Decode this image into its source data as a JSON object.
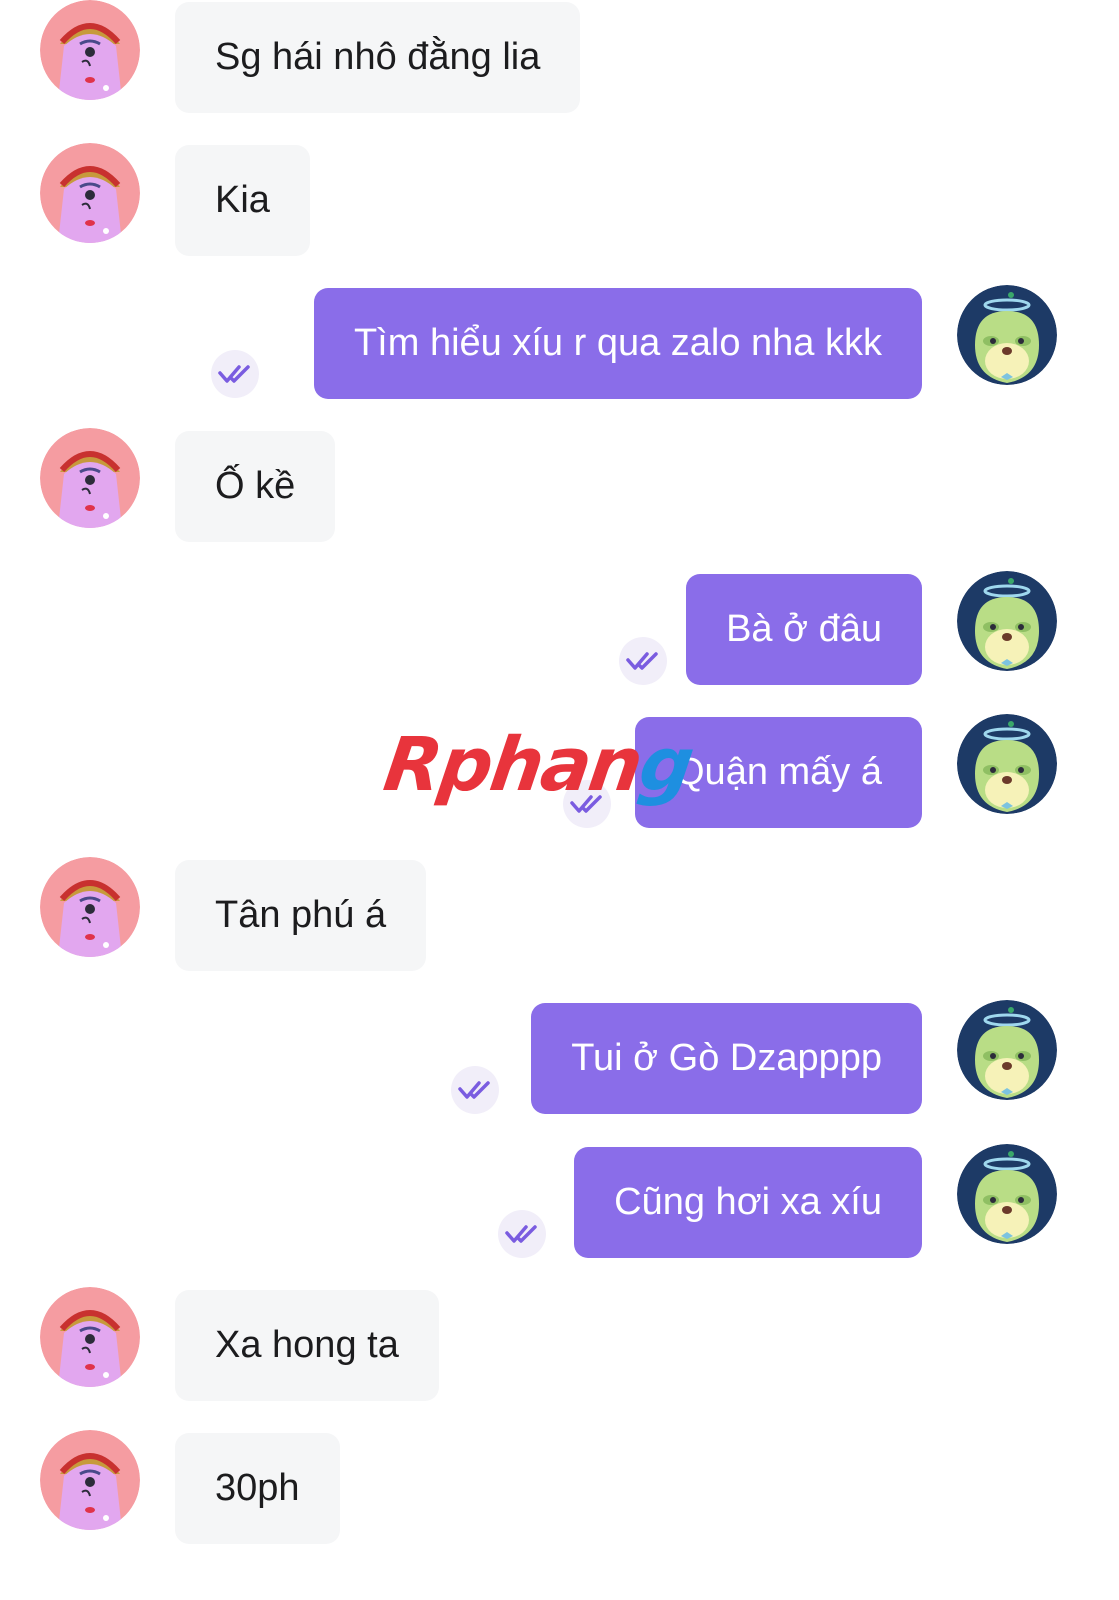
{
  "colors": {
    "outgoing_bubble": "#8a6de9",
    "incoming_bubble": "#f5f6f7",
    "seen_icon": "#7a5ce0"
  },
  "messages": [
    {
      "side": "in",
      "text": "Sg hái nhô đằng lia"
    },
    {
      "side": "in",
      "text": "Kia"
    },
    {
      "side": "out",
      "text": "Tìm hiểu xíu r qua zalo nha kkk",
      "seen": true
    },
    {
      "side": "in",
      "text": "Ố kề"
    },
    {
      "side": "out",
      "text": "Bà ở đâu",
      "seen": true
    },
    {
      "side": "out",
      "text": "Quận mấy á",
      "seen": true
    },
    {
      "side": "in",
      "text": "Tân phú á"
    },
    {
      "side": "out",
      "text": "Tui ở Gò Dzapppp",
      "seen": true
    },
    {
      "side": "out",
      "text": "Cũng hơi xa xíu",
      "seen": true
    },
    {
      "side": "in",
      "text": "Xa hong ta"
    },
    {
      "side": "in",
      "text": "30ph"
    }
  ],
  "watermark": {
    "part1": "Rphan",
    "part2": "g"
  },
  "icons": {
    "incoming_avatar": "pink-monster-avatar-icon",
    "outgoing_avatar": "green-halo-creature-avatar-icon",
    "seen": "double-check-icon"
  }
}
